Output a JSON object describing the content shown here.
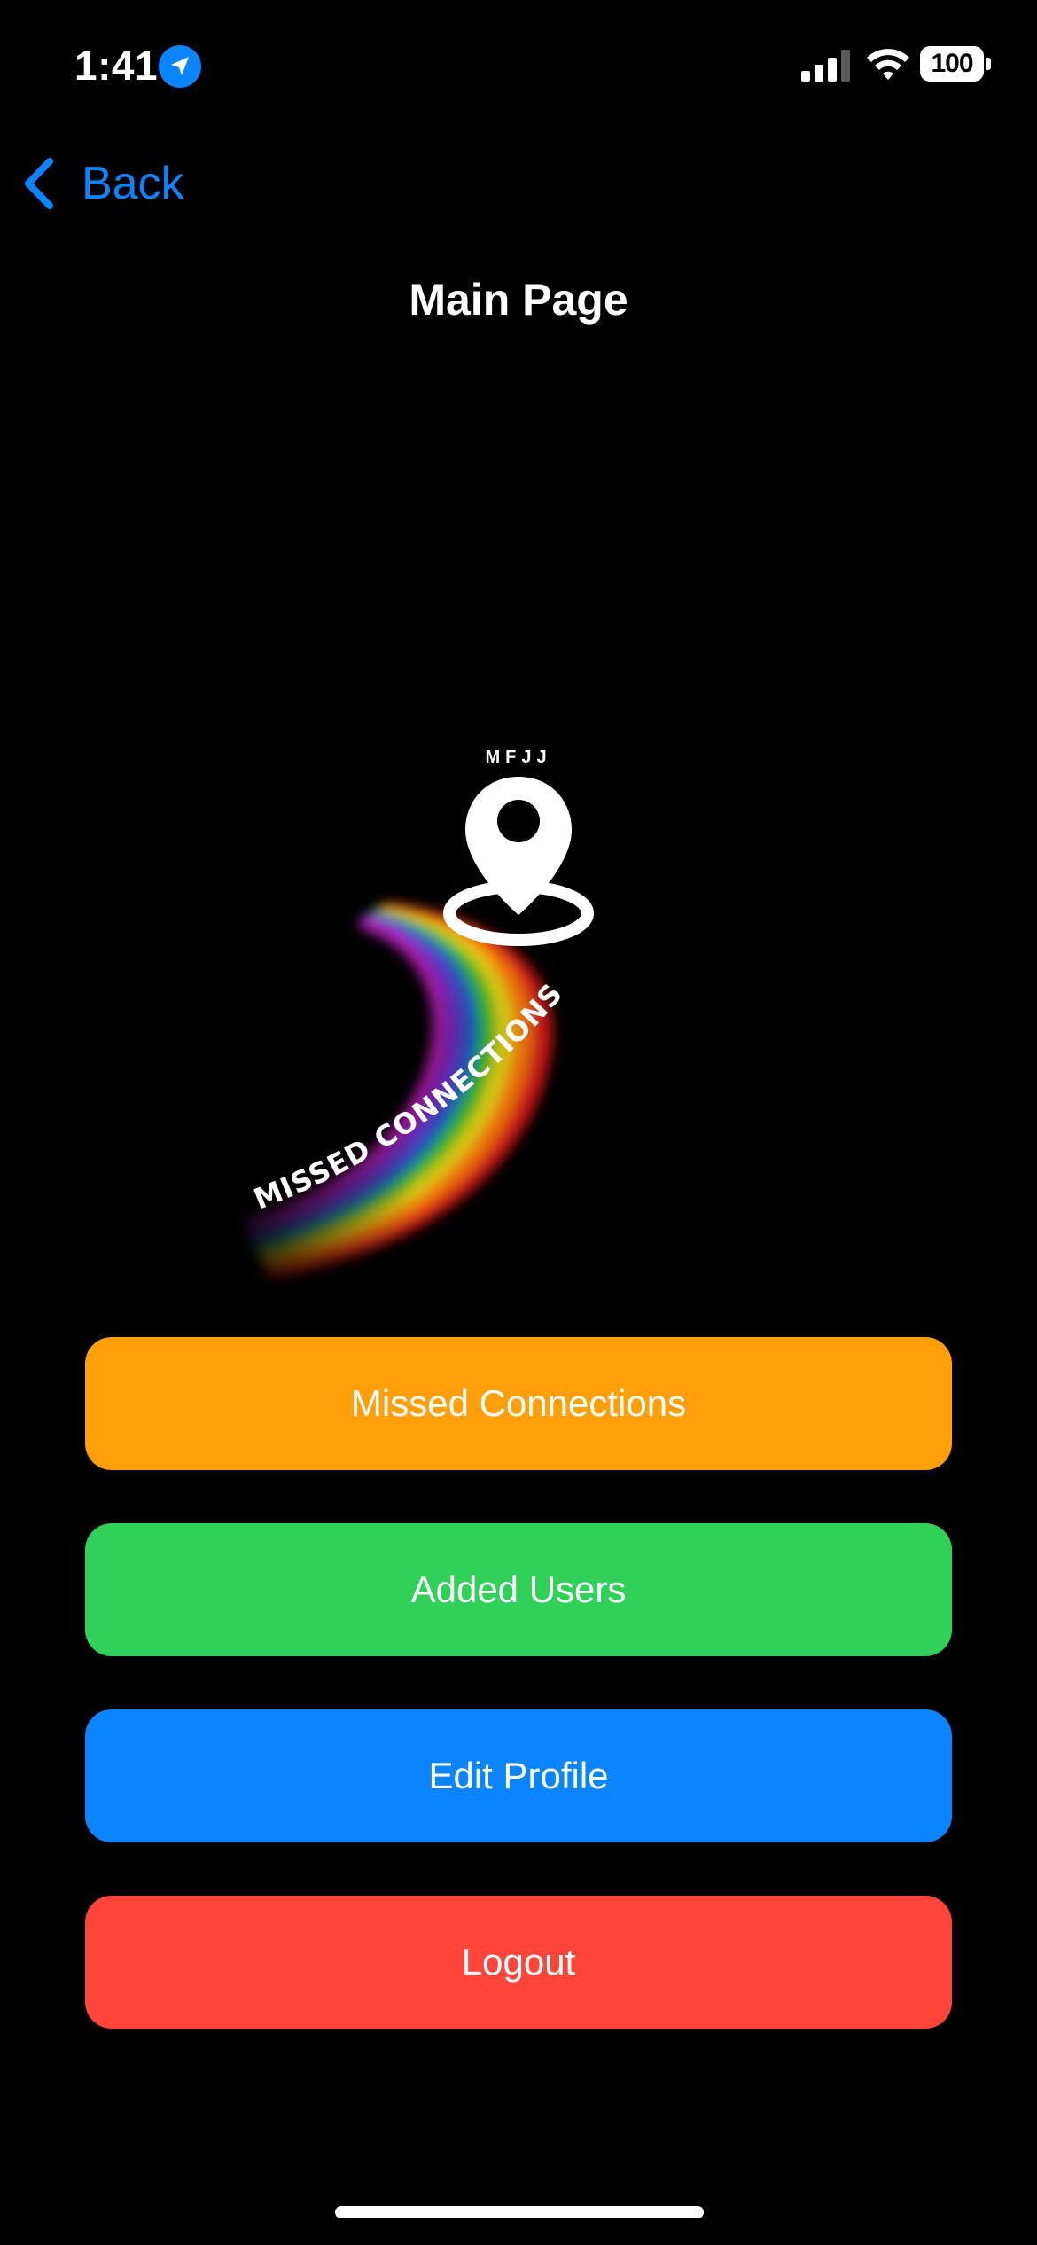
{
  "status_bar": {
    "time": "1:41",
    "battery": "100"
  },
  "nav": {
    "back_label": "Back",
    "title": "Main Page"
  },
  "logo": {
    "top_text": "MFJJ",
    "arc_text": "MISSED CONNECTIONS"
  },
  "buttons": [
    {
      "label": "Missed Connections",
      "color": "#ff9f0a"
    },
    {
      "label": "Added Users",
      "color": "#30d158"
    },
    {
      "label": "Edit Profile",
      "color": "#0a84ff"
    },
    {
      "label": "Logout",
      "color": "#ff453a"
    }
  ],
  "colors": {
    "accent": "#0a84ff",
    "background": "#000000"
  },
  "icons": [
    "location-arrow-icon",
    "cellular-signal-icon",
    "wifi-icon",
    "battery-icon",
    "chevron-left-icon",
    "map-pin-icon"
  ]
}
